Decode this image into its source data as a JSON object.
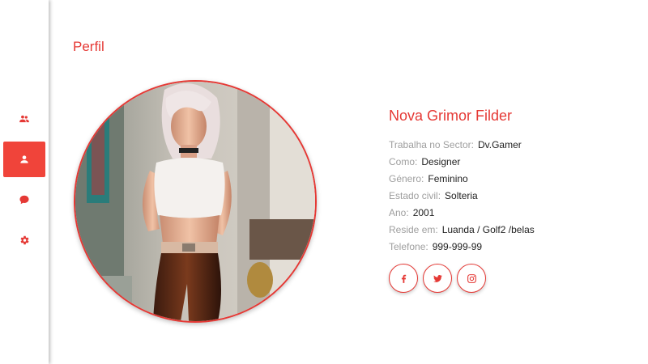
{
  "colors": {
    "accent": "#e53935",
    "label": "#9e9e9e",
    "value": "#222222"
  },
  "sidebar": {
    "items": [
      {
        "icon": "group-icon",
        "active": false
      },
      {
        "icon": "person-icon",
        "active": true
      },
      {
        "icon": "chat-bubble-icon",
        "active": false
      },
      {
        "icon": "gear-icon",
        "active": false
      }
    ]
  },
  "page": {
    "title": "Perfil"
  },
  "profile": {
    "name": "Nova Grimor Filder",
    "fields": [
      {
        "label": "Trabalha no Sector:",
        "value": "Dv.Gamer"
      },
      {
        "label": "Como:",
        "value": "Designer"
      },
      {
        "label": "Género:",
        "value": "Feminino"
      },
      {
        "label": "Estado civil:",
        "value": "Solteria"
      },
      {
        "label": "Ano:",
        "value": "2001"
      },
      {
        "label": "Reside em:",
        "value": "Luanda / Golf2 /belas"
      },
      {
        "label": "Telefone:",
        "value": "999-999-99"
      }
    ]
  },
  "socials": [
    {
      "icon": "facebook-icon"
    },
    {
      "icon": "twitter-icon"
    },
    {
      "icon": "instagram-icon"
    }
  ]
}
